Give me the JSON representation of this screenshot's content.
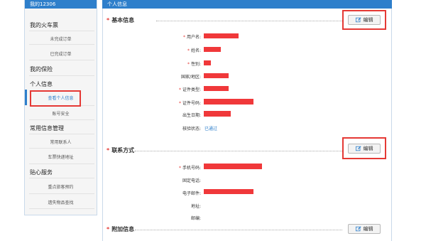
{
  "sidebar": {
    "header": "我的12306",
    "groups": [
      {
        "label": "我的火车票",
        "items": [
          "未完成订单",
          "已完成订单"
        ]
      },
      {
        "label": "我的保险",
        "items": []
      },
      {
        "label": "个人信息",
        "items": [
          "查看个人信息",
          "账号安全"
        ]
      },
      {
        "label": "常用信息管理",
        "items": [
          "常用联系人",
          "车票快递地址"
        ]
      },
      {
        "label": "贴心服务",
        "items": [
          "重点旅客预约",
          "遗失物品查找"
        ]
      }
    ],
    "active_item": "查看个人信息"
  },
  "main": {
    "header": "个人信息",
    "edit_label": "编辑",
    "sections": [
      {
        "title": "基本信息",
        "fields": [
          {
            "label": "用户名:",
            "required": true,
            "value": ""
          },
          {
            "label": "姓名:",
            "required": true,
            "value": ""
          },
          {
            "label": "性别:",
            "required": true,
            "value": ""
          },
          {
            "label": "国家/地区:",
            "required": false,
            "value": ""
          },
          {
            "label": "证件类型:",
            "required": true,
            "value": ""
          },
          {
            "label": "证件号码:",
            "required": true,
            "value": ""
          },
          {
            "label": "出生日期:",
            "required": false,
            "value": ""
          },
          {
            "label": "核验状态:",
            "required": false,
            "value": "已通过"
          }
        ]
      },
      {
        "title": "联系方式",
        "fields": [
          {
            "label": "手机号码:",
            "required": true,
            "value": ""
          },
          {
            "label": "固定电话:",
            "required": false,
            "value": ""
          },
          {
            "label": "电子邮件:",
            "required": false,
            "value": ""
          },
          {
            "label": "地址:",
            "required": false,
            "value": ""
          },
          {
            "label": "邮编:",
            "required": false,
            "value": ""
          }
        ]
      },
      {
        "title": "附加信息",
        "fields": []
      }
    ]
  },
  "colors": {
    "accent": "#2e7fcb",
    "highlight": "#e53935",
    "redaction": "#f0383a"
  },
  "icons": {
    "edit": "edit-icon"
  }
}
